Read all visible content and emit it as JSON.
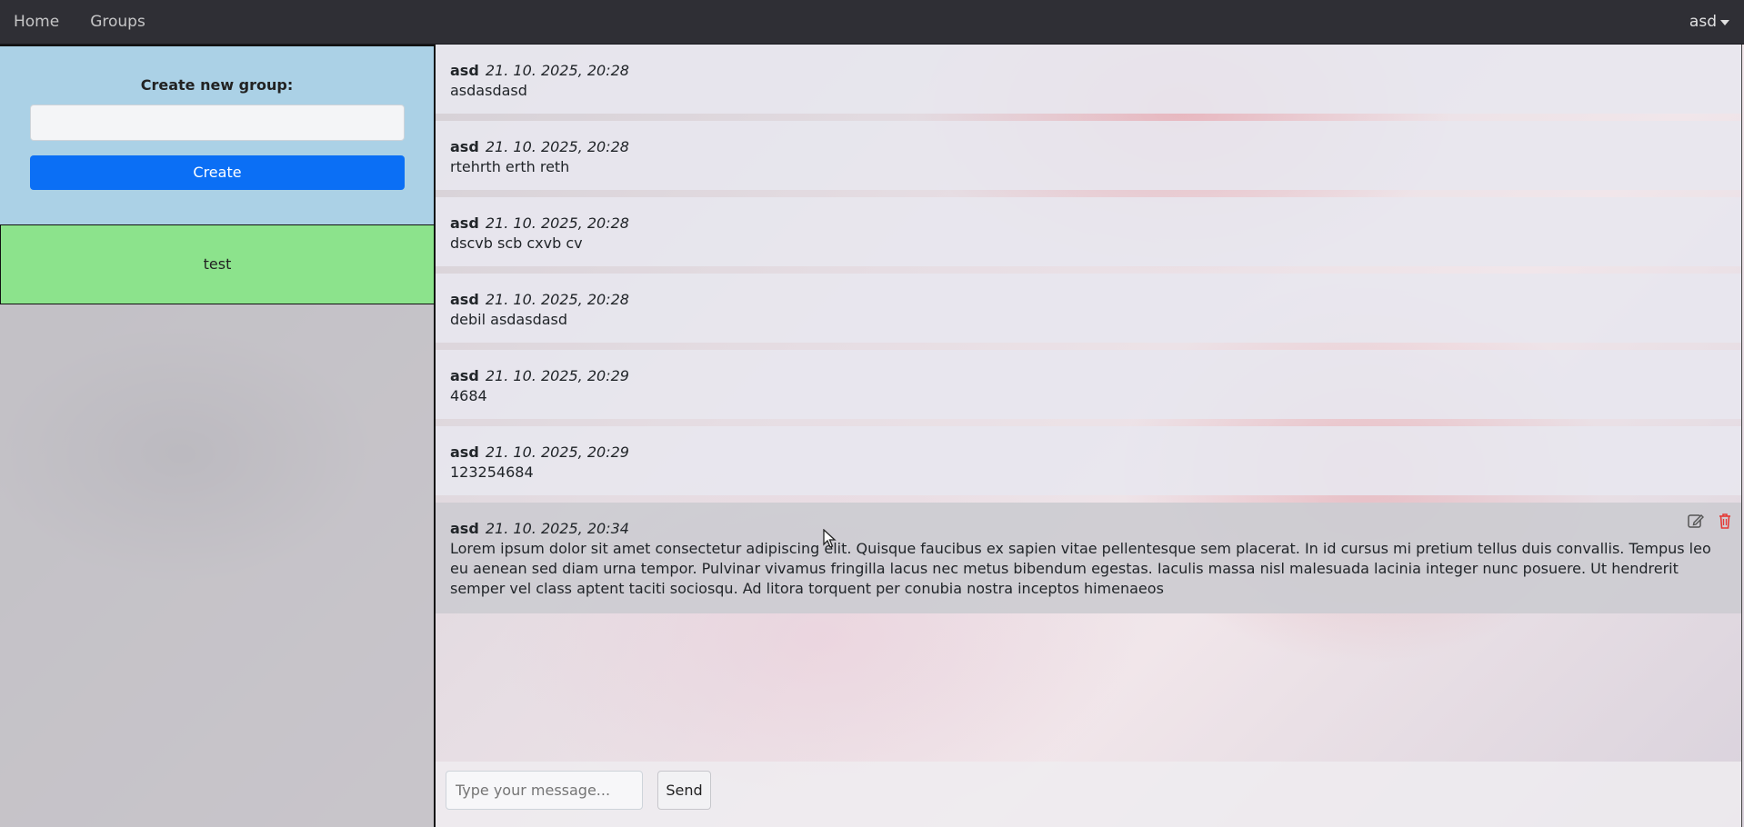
{
  "nav": {
    "links": [
      "Home",
      "Groups"
    ],
    "user": "asd"
  },
  "sidebar": {
    "create_title": "Create new group:",
    "create_input_value": "",
    "create_button": "Create",
    "groups": [
      "test"
    ],
    "colors": {
      "create_panel": "#aad2e8",
      "group_active": "#8ce38c",
      "button": "#0b6ff5"
    }
  },
  "messages": [
    {
      "author": "asd",
      "time": "21. 10. 2025, 20:28",
      "text": "asdasdasd"
    },
    {
      "author": "asd",
      "time": "21. 10. 2025, 20:28",
      "text": "rtehrth erth reth"
    },
    {
      "author": "asd",
      "time": "21. 10. 2025, 20:28",
      "text": "dscvb scb cxvb cv"
    },
    {
      "author": "asd",
      "time": "21. 10. 2025, 20:28",
      "text": "debil asdasdasd"
    },
    {
      "author": "asd",
      "time": "21. 10. 2025, 20:29",
      "text": "4684"
    },
    {
      "author": "asd",
      "time": "21. 10. 2025, 20:29",
      "text": "123254684"
    },
    {
      "author": "asd",
      "time": "21. 10. 2025, 20:34",
      "text": "Lorem ipsum dolor sit amet consectetur adipiscing elit. Quisque faucibus ex sapien vitae pellentesque sem placerat. In id cursus mi pretium tellus duis convallis. Tempus leo eu aenean sed diam urna tempor. Pulvinar vivamus fringilla lacus nec metus bibendum egestas. Iaculis massa nisl malesuada lacinia integer nunc posuere. Ut hendrerit semper vel class aptent taciti sociosqu. Ad litora torquent per conubia nostra inceptos himenaeos",
      "actions": [
        "edit-icon",
        "trash-icon"
      ]
    }
  ],
  "composer": {
    "placeholder": "Type your message...",
    "value": "",
    "send_label": "Send"
  }
}
